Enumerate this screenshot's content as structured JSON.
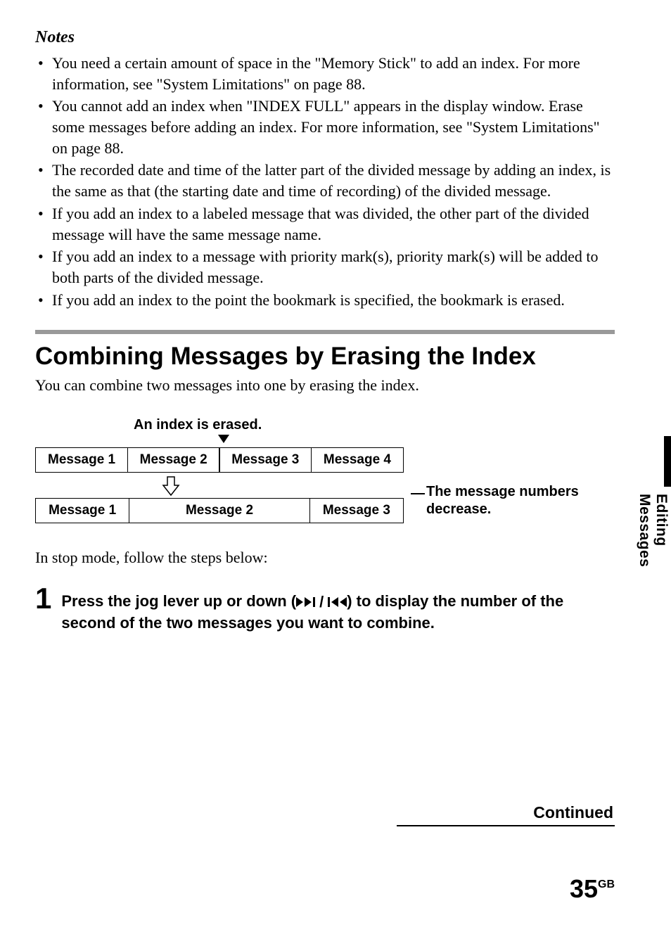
{
  "notes_heading": "Notes",
  "notes": [
    "You need a certain amount of space in the \"Memory Stick\" to add an index. For more information, see \"System Limitations\" on page 88.",
    "You cannot add an index when \"INDEX FULL\" appears in the display window. Erase some messages before adding an index. For more information, see \"System Limitations\" on page 88.",
    "The recorded date and time of the latter part of the divided message by adding an index, is the same as that  (the starting date and time of recording) of the divided message.",
    "If you add an index to a labeled message that was divided, the other part of the divided message will have the same message name.",
    "If you add an index to a message with priority mark(s), priority mark(s) will be added to both parts of the divided message.",
    "If you add an index to the point the bookmark is specified, the bookmark is erased."
  ],
  "section_heading": "Combining Messages by Erasing the Index",
  "section_body": "You can combine two messages into one by erasing the index.",
  "diagram": {
    "caption": "An index is erased.",
    "row1": [
      "Message 1",
      "Message 2",
      "Message 3",
      "Message 4"
    ],
    "row2": [
      "Message 1",
      "Message 2",
      "Message 3"
    ],
    "right_note": "The message numbers decrease."
  },
  "stop_mode_text": "In stop mode, follow the steps below:",
  "step": {
    "num": "1",
    "before": "Press the jog lever up or down (",
    "after": ") to display the number of the second of the two messages you want to combine."
  },
  "side_label": "Editing Messages",
  "continued": "Continued",
  "page": {
    "num": "35",
    "suffix": "GB"
  }
}
